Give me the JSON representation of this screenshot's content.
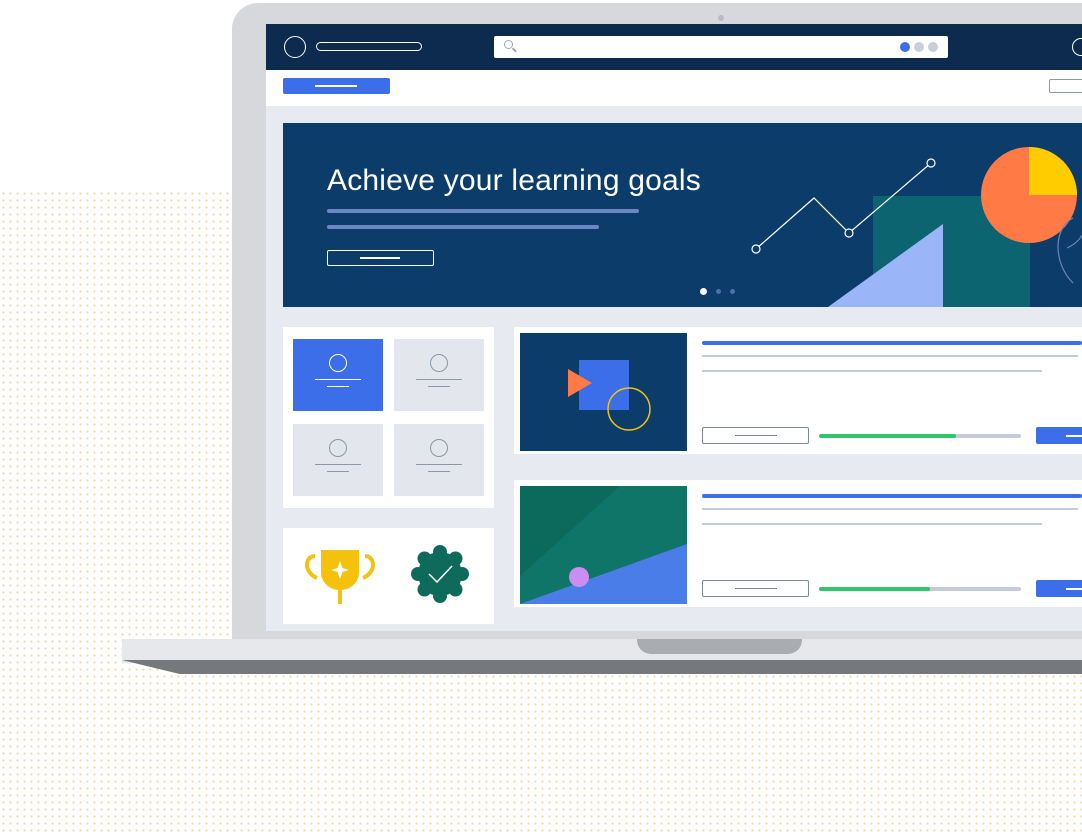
{
  "hero": {
    "title": "Achieve your learning goals",
    "carousel_slides": 3,
    "carousel_active_index": 0
  },
  "icons": {
    "logo": "logo-circle-icon",
    "search": "search-icon",
    "trophy": "trophy-icon",
    "certificate": "certificate-badge-icon"
  },
  "courses": [
    {
      "progress": 0.68
    },
    {
      "progress": 0.55
    }
  ],
  "colors": {
    "nav_dark": "#0d2b4e",
    "hero_bg": "#0c3d6a",
    "accent_blue": "#3b6ee8",
    "progress_green": "#2fc56a",
    "pie_orange": "#ff7a45",
    "pie_yellow": "#ffcc00",
    "badge_green": "#0e6b5c",
    "trophy_yellow": "#f4c20d"
  }
}
